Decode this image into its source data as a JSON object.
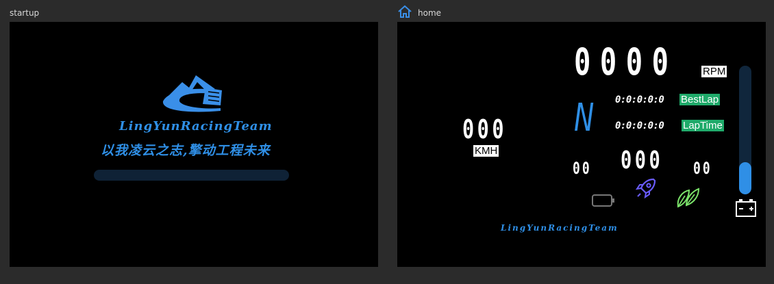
{
  "panels": {
    "startup": {
      "title": "startup",
      "team_name": "LingYunRacingTeam",
      "slogan": "以我凌云之志,擎动工程未来",
      "progress": 0
    },
    "home": {
      "title": "home",
      "rpm": {
        "value": "0000",
        "unit": "RPM"
      },
      "gear": "N",
      "best_lap": {
        "value": "0:0:0:0:0",
        "label": "BestLap"
      },
      "lap_time": {
        "value": "0:0:0:0:0",
        "label": "LapTime"
      },
      "speed": {
        "value": "000",
        "unit": "KMH"
      },
      "left_value": "00",
      "center_value": "000",
      "right_value": "00",
      "team_name": "LingYunRacingTeam",
      "side_bar_level": 0.25
    }
  },
  "icons": {
    "home_tab": "home-icon",
    "battery": "battery-icon",
    "rocket": "rocket-icon",
    "leaf": "eco-leaf-icon",
    "car_battery": "car-battery-icon",
    "logo": "mountain-road-logo"
  },
  "colors": {
    "background": "#2b2b2b",
    "screen": "#000000",
    "accent_blue": "#2f8fe6",
    "label_green": "#1faa6a",
    "rocket": "#6a5cff",
    "leaf": "#7be36a"
  }
}
